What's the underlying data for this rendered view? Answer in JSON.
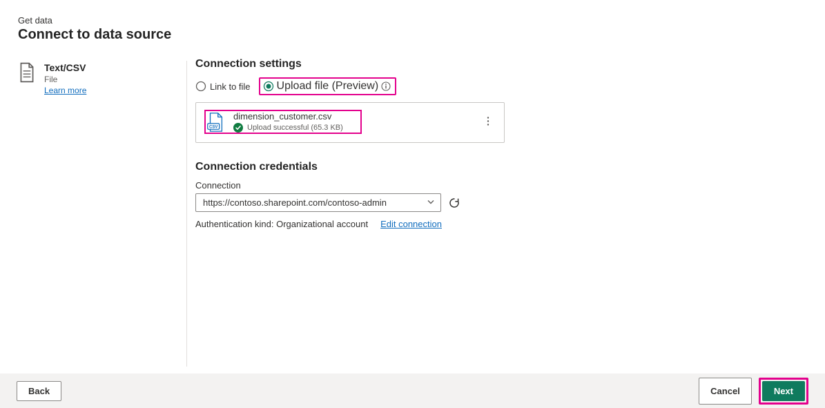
{
  "breadcrumb": "Get data",
  "title": "Connect to data source",
  "connector": {
    "name": "Text/CSV",
    "subtype": "File",
    "learn_more": "Learn more"
  },
  "section_settings": "Connection settings",
  "radio": {
    "link_to_file": "Link to file",
    "upload_file": "Upload file (Preview)"
  },
  "file": {
    "name": "dimension_customer.csv",
    "status": "Upload successful (65.3 KB)"
  },
  "section_credentials": "Connection credentials",
  "connection_label": "Connection",
  "connection_value": "https://contoso.sharepoint.com/contoso-admin",
  "auth_kind_label": "Authentication kind:",
  "auth_kind_value": "Organizational account",
  "edit_connection": "Edit connection",
  "buttons": {
    "back": "Back",
    "cancel": "Cancel",
    "next": "Next"
  }
}
